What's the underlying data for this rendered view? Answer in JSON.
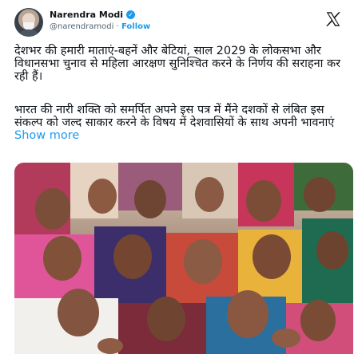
{
  "author": {
    "name": "Narendra Modi",
    "handle": "@narendramodi",
    "separator": "·",
    "follow_label": "Follow",
    "verified_icon": "verified-badge-icon",
    "verified_color": "#1d9bf0"
  },
  "platform_icon": "x-logo-icon",
  "tweet": {
    "paragraph_1": "देशभर की हमारी माताएं-बहनें और बेटियां, साल 2029 के लोकसभा और विधानसभा चुनाव से महिला आरक्षण सुनिश्चित करने के निर्णय की सराहना कर रही हैं।",
    "paragraph_2": "भारत की नारी शक्ति को समर्पित अपने इस पत्र में मैंने दशकों से लंबित इस संकल्प को जल्द साकार करने के विषय में देशवासियों के साथ अपनी भावनाएं",
    "show_more_label": "Show more"
  },
  "colors": {
    "link": "#1d9bf0",
    "text": "#0f1419",
    "muted": "#536471"
  }
}
